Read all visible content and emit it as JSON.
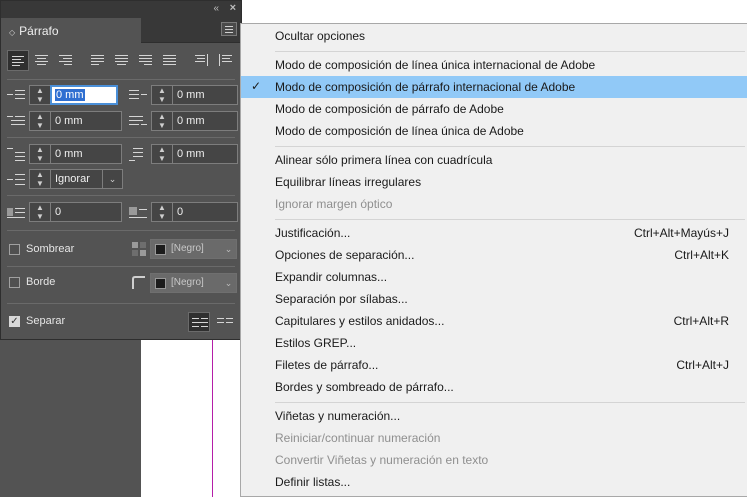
{
  "panel": {
    "title": "Párrafo",
    "indent_left": "0 mm",
    "indent_right": "0 mm",
    "indent_first_line": "0 mm",
    "indent_last_line": "0 mm",
    "space_before": "0 mm",
    "space_after": "0 mm",
    "align_to_grid": "Ignorar",
    "drop_cap_lines": "0",
    "drop_cap_chars": "0",
    "shading": {
      "label": "Sombrear",
      "color": "[Negro]",
      "checked": false
    },
    "border": {
      "label": "Borde",
      "color": "[Negro]",
      "checked": false
    },
    "span": {
      "label": "Separar",
      "checked": true
    },
    "icons": {
      "collapse": "«",
      "close": "×",
      "diamond": "◇",
      "stepper_up": "▲",
      "stepper_down": "▼",
      "dropdown": "⌄",
      "check": "✓"
    }
  },
  "menu": {
    "items": [
      {
        "label": "Ocultar opciones",
        "shortcut": "",
        "disabled": false,
        "checked": false
      },
      {
        "label": "Modo de composición de línea única internacional de Adobe",
        "shortcut": "",
        "disabled": false,
        "checked": false
      },
      {
        "label": "Modo de composición de párrafo internacional de Adobe",
        "shortcut": "",
        "disabled": false,
        "checked": true
      },
      {
        "label": "Modo de composición de párrafo de Adobe",
        "shortcut": "",
        "disabled": false,
        "checked": false
      },
      {
        "label": "Modo de composición de línea única de Adobe",
        "shortcut": "",
        "disabled": false,
        "checked": false
      },
      {
        "label": "Alinear sólo primera línea con cuadrícula",
        "shortcut": "",
        "disabled": false,
        "checked": false
      },
      {
        "label": "Equilibrar líneas irregulares",
        "shortcut": "",
        "disabled": false,
        "checked": false
      },
      {
        "label": "Ignorar margen óptico",
        "shortcut": "",
        "disabled": true,
        "checked": false
      },
      {
        "label": "Justificación...",
        "shortcut": "Ctrl+Alt+Mayús+J",
        "disabled": false,
        "checked": false
      },
      {
        "label": "Opciones de separación...",
        "shortcut": "Ctrl+Alt+K",
        "disabled": false,
        "checked": false
      },
      {
        "label": "Expandir columnas...",
        "shortcut": "",
        "disabled": false,
        "checked": false
      },
      {
        "label": "Separación por sílabas...",
        "shortcut": "",
        "disabled": false,
        "checked": false
      },
      {
        "label": "Capitulares y estilos anidados...",
        "shortcut": "Ctrl+Alt+R",
        "disabled": false,
        "checked": false
      },
      {
        "label": "Estilos GREP...",
        "shortcut": "",
        "disabled": false,
        "checked": false
      },
      {
        "label": "Filetes de párrafo...",
        "shortcut": "Ctrl+Alt+J",
        "disabled": false,
        "checked": false
      },
      {
        "label": "Bordes y sombreado de párrafo...",
        "shortcut": "",
        "disabled": false,
        "checked": false
      },
      {
        "label": "Viñetas y numeración...",
        "shortcut": "",
        "disabled": false,
        "checked": false
      },
      {
        "label": "Reiniciar/continuar numeración",
        "shortcut": "",
        "disabled": true,
        "checked": false
      },
      {
        "label": "Convertir Viñetas y numeración en texto",
        "shortcut": "",
        "disabled": true,
        "checked": false
      },
      {
        "label": "Definir listas...",
        "shortcut": "",
        "disabled": false,
        "checked": false
      }
    ]
  },
  "colors": {
    "panel_bg": "#535353",
    "menu_bg": "#f0f0f0",
    "menu_highlight": "#91c9f7",
    "focus_border": "#4a8fd8",
    "guide": "#b41ea8"
  }
}
